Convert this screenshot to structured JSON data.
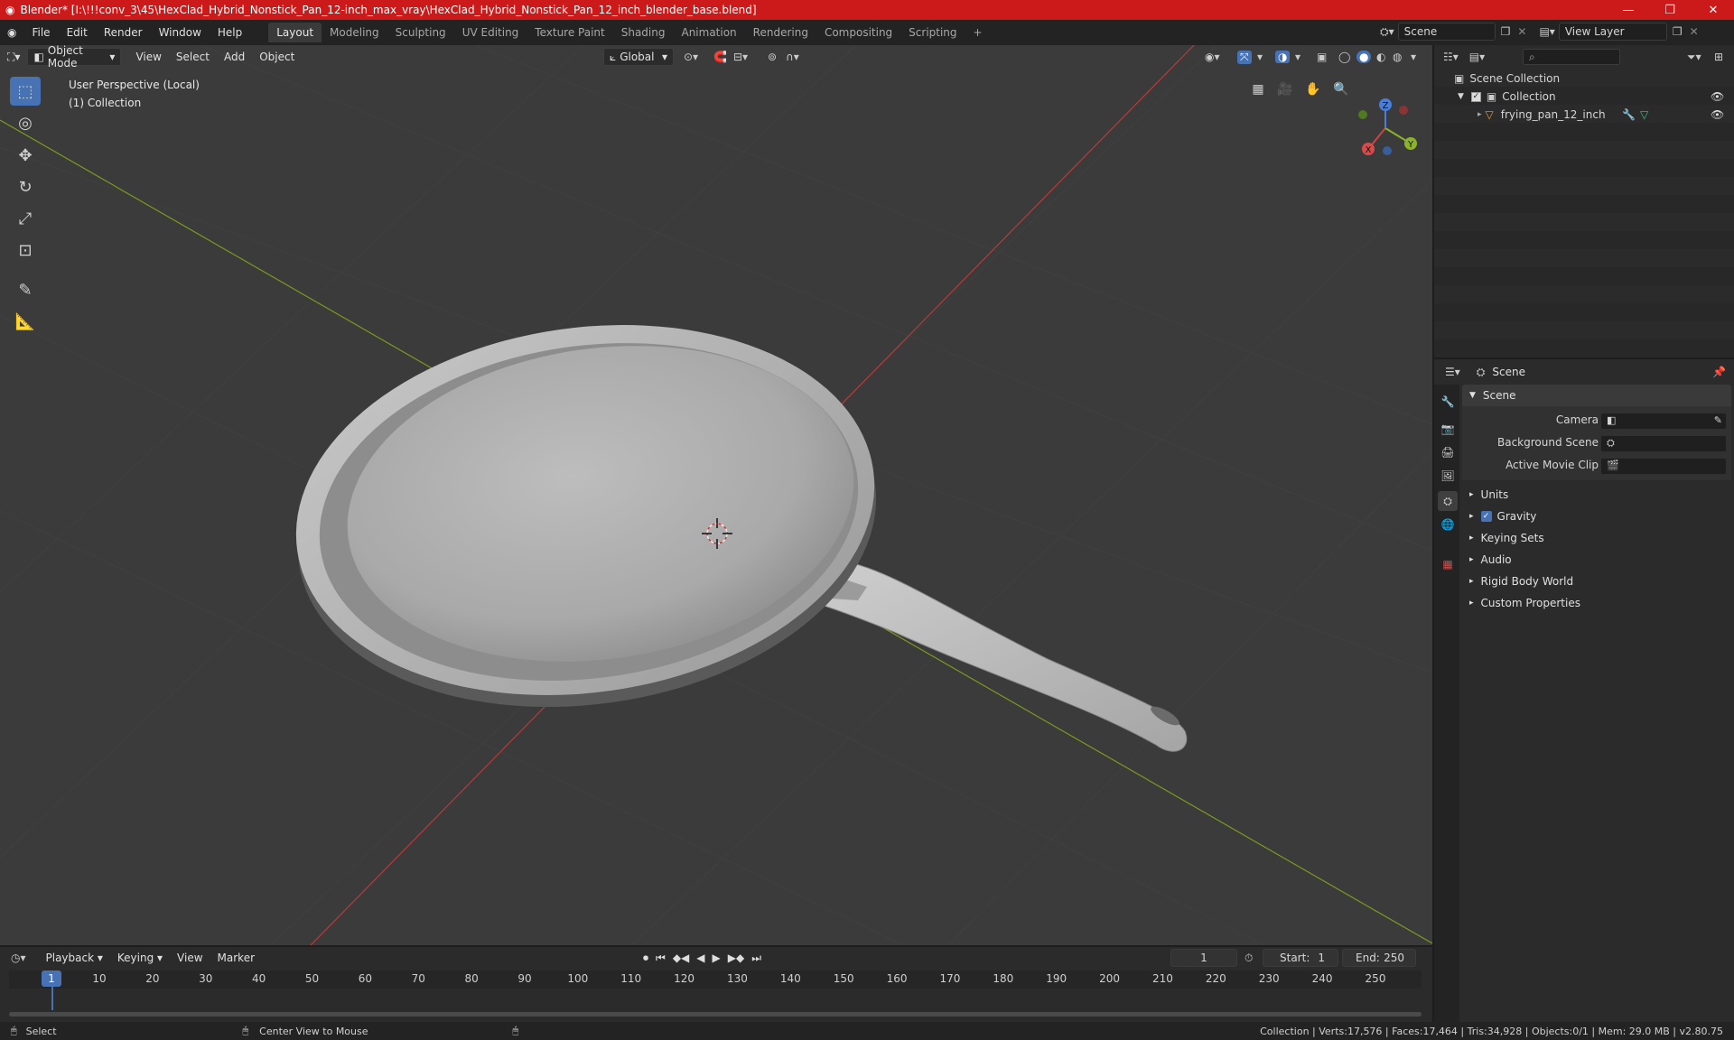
{
  "window": {
    "title": "Blender* [I:\\!!!conv_3\\45\\HexClad_Hybrid_Nonstick_Pan_12-inch_max_vray\\HexClad_Hybrid_Nonstick_Pan_12_inch_blender_base.blend]"
  },
  "menus": [
    "File",
    "Edit",
    "Render",
    "Window",
    "Help"
  ],
  "workspaces": [
    "Layout",
    "Modeling",
    "Sculpting",
    "UV Editing",
    "Texture Paint",
    "Shading",
    "Animation",
    "Rendering",
    "Compositing",
    "Scripting"
  ],
  "active_workspace": "Layout",
  "scene_field": "Scene",
  "view_layer_field": "View Layer",
  "viewport": {
    "mode": "Object Mode",
    "menus": [
      "View",
      "Select",
      "Add",
      "Object"
    ],
    "transform": "Global",
    "overlay_line1": "User Perspective (Local)",
    "overlay_line2": "(1) Collection",
    "gizmo": {
      "x": "X",
      "y": "Y",
      "z": "Z"
    }
  },
  "outliner": {
    "root": "Scene Collection",
    "collection": "Collection",
    "object": "frying_pan_12_inch"
  },
  "properties": {
    "header": "Scene",
    "panel_title": "Scene",
    "fields": [
      {
        "label": "Camera"
      },
      {
        "label": "Background Scene"
      },
      {
        "label": "Active Movie Clip"
      }
    ],
    "sections": [
      "Units",
      "Gravity",
      "Keying Sets",
      "Audio",
      "Rigid Body World",
      "Custom Properties"
    ]
  },
  "timeline": {
    "menus": [
      "Playback",
      "Keying",
      "View",
      "Marker"
    ],
    "current_frame": "1",
    "start_label": "Start:",
    "start_value": "1",
    "end_label": "End:",
    "end_value": "250",
    "ticks": [
      "1",
      "10",
      "20",
      "30",
      "40",
      "50",
      "60",
      "70",
      "80",
      "90",
      "100",
      "110",
      "120",
      "130",
      "140",
      "150",
      "160",
      "170",
      "180",
      "190",
      "200",
      "210",
      "220",
      "230",
      "240",
      "250"
    ]
  },
  "status": {
    "left1": "Select",
    "left2": "Center View to Mouse",
    "right": "Collection | Verts:17,576 | Faces:17,464 | Tris:34,928 | Objects:0/1 | Mem: 29.0 MB | v2.80.75"
  },
  "colors": {
    "accent": "#4772b3",
    "titlebar": "#cc1a1a",
    "axis_x": "#b93a3a",
    "axis_y": "#7a9a1e"
  }
}
